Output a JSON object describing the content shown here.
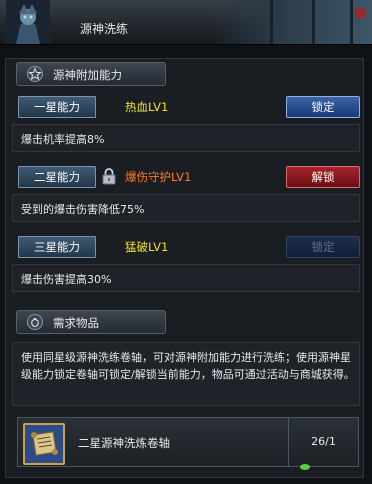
{
  "window": {
    "title": "源神洗练"
  },
  "section_abilities": {
    "label": "源神附加能力",
    "icon": "star-icon"
  },
  "rows": [
    {
      "star_label": "一星能力",
      "ability": "热血LV1",
      "ability_color": "#f0e228",
      "locked": false,
      "action": "锁定",
      "action_state": "active-blue",
      "description": "爆击机率提高8%"
    },
    {
      "star_label": "二星能力",
      "ability": "爆伤守护LV1",
      "ability_color": "#ff7a1a",
      "locked": true,
      "action": "解锁",
      "action_state": "active-red",
      "description": "受到的爆击伤害降低75%"
    },
    {
      "star_label": "三星能力",
      "ability": "猛破LV1",
      "ability_color": "#f0e228",
      "locked": false,
      "action": "锁定",
      "action_state": "disabled",
      "description": "爆击伤害提高30%"
    }
  ],
  "section_requirements": {
    "label": "需求物品",
    "icon": "bag-icon"
  },
  "requirements_text": "使用同星级源神洗练卷轴，可对源神附加能力进行洗练；使用源神星级能力锁定卷轴可锁定/解锁当前能力，物品可通过活动与商城获得。",
  "item": {
    "icon": "scroll-icon",
    "name": "二星源神洗炼卷轴",
    "count": "26/1"
  }
}
